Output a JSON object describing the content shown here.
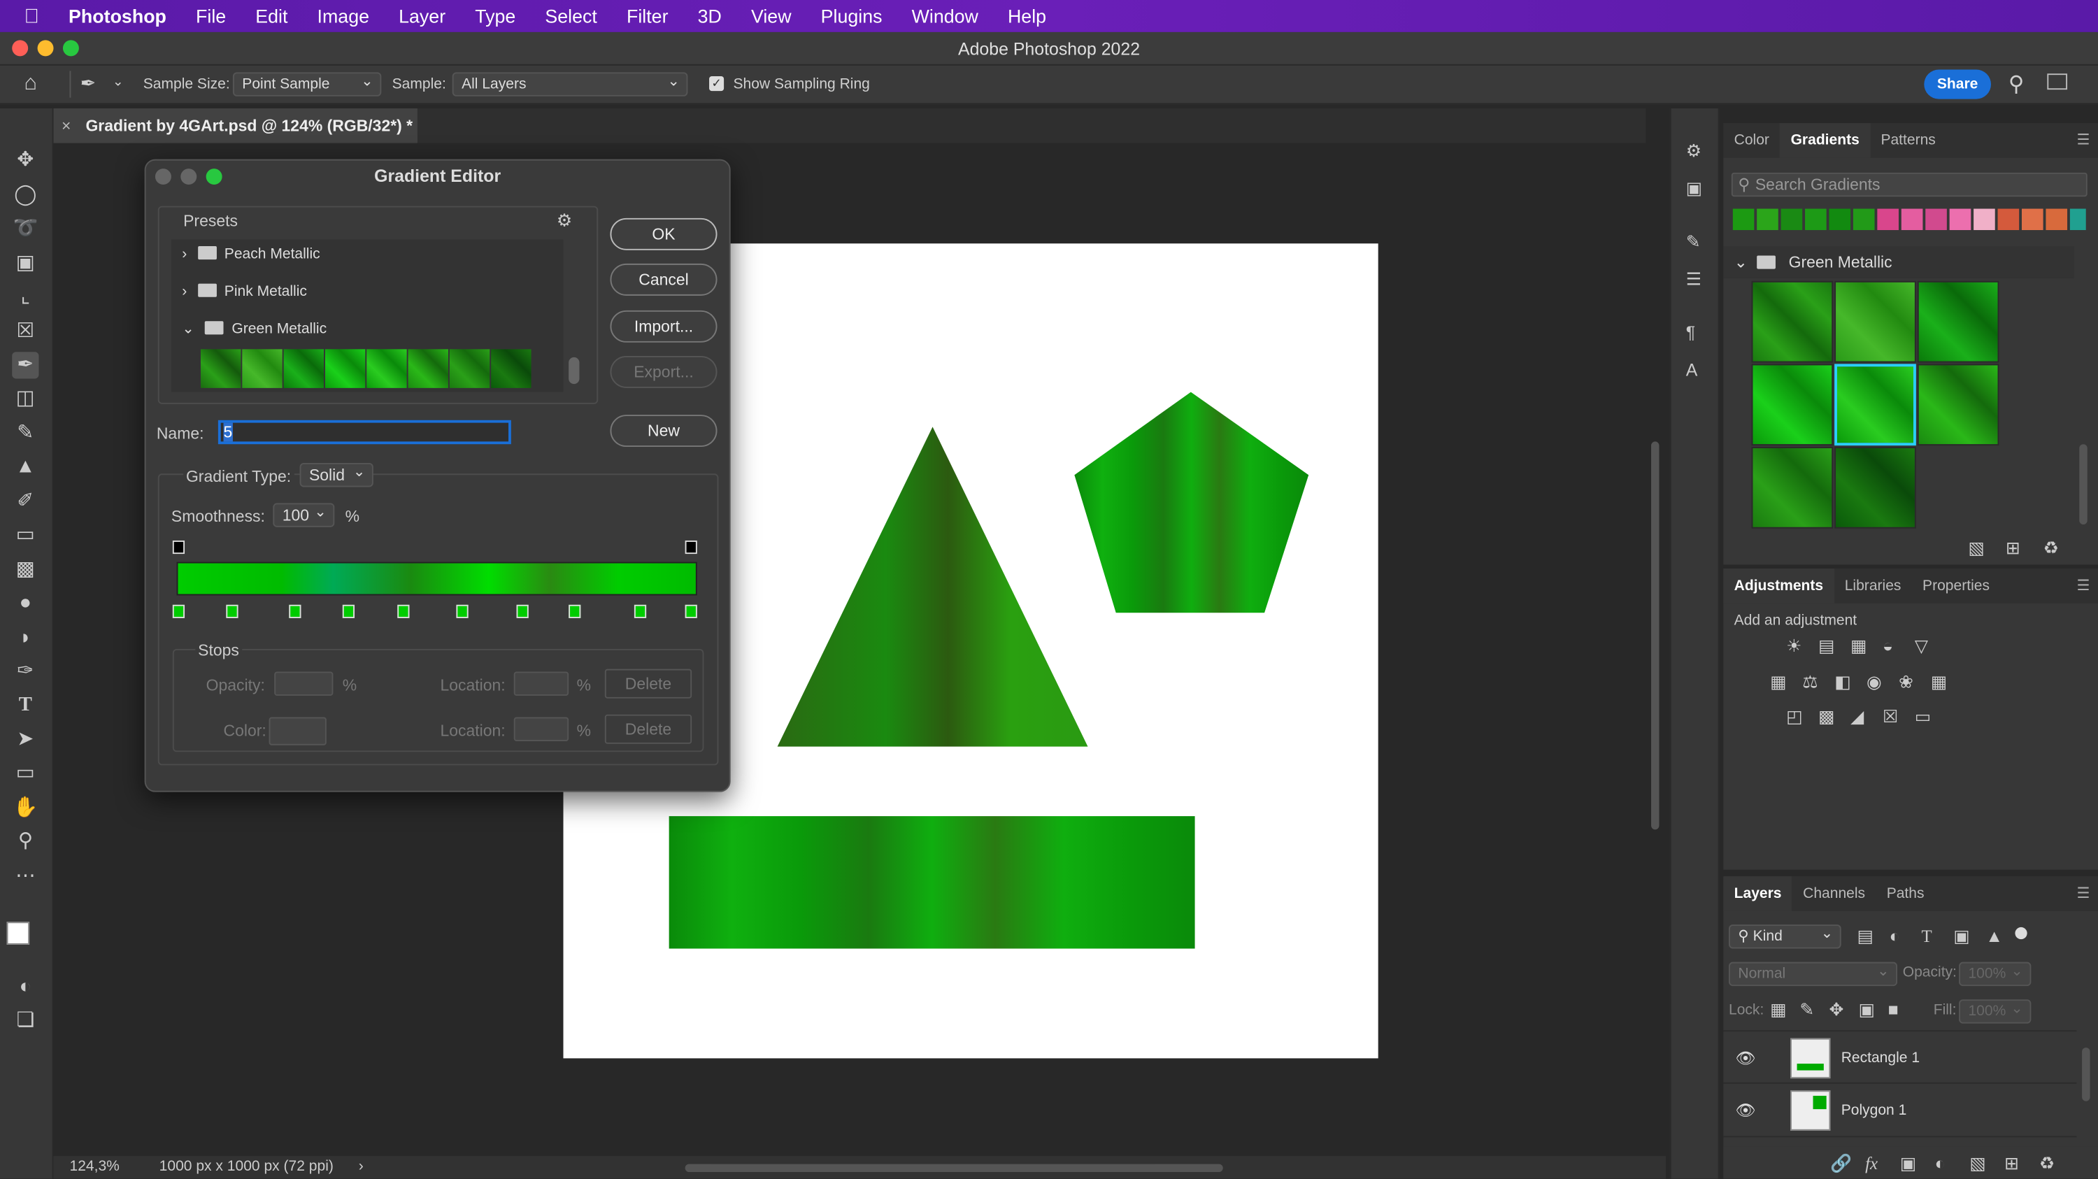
{
  "menubar": {
    "app": "Photoshop",
    "items": [
      "File",
      "Edit",
      "Image",
      "Layer",
      "Type",
      "Select",
      "Filter",
      "3D",
      "View",
      "Plugins",
      "Window",
      "Help"
    ]
  },
  "window": {
    "title": "Adobe Photoshop 2022"
  },
  "options": {
    "sample_size_label": "Sample Size:",
    "sample_size_value": "Point Sample",
    "sample_label": "Sample:",
    "sample_value": "All Layers",
    "show_ring_label": "Show Sampling Ring",
    "share_label": "Share"
  },
  "document": {
    "tab_title": "Gradient by 4GArt.psd @ 124% (RGB/32*) *",
    "zoom": "124,3%",
    "info": "1000 px x 1000 px (72 ppi)"
  },
  "dialog": {
    "title": "Gradient Editor",
    "presets_label": "Presets",
    "folders": [
      "Peach Metallic",
      "Pink Metallic",
      "Green Metallic"
    ],
    "buttons": {
      "ok": "OK",
      "cancel": "Cancel",
      "import": "Import...",
      "export": "Export...",
      "new": "New"
    },
    "name_label": "Name:",
    "name_value": "5",
    "gradient_type_label": "Gradient Type:",
    "gradient_type_value": "Solid",
    "smoothness_label": "Smoothness:",
    "smoothness_value": "100",
    "percent": "%",
    "stops_label": "Stops",
    "opacity_label": "Opacity:",
    "location_label": "Location:",
    "color_label": "Color:",
    "delete_label": "Delete"
  },
  "gradients_panel": {
    "tabs": [
      "Color",
      "Gradients",
      "Patterns"
    ],
    "search_placeholder": "Search Gradients",
    "group": "Green Metallic"
  },
  "adjustments_panel": {
    "tabs": [
      "Adjustments",
      "Libraries",
      "Properties"
    ],
    "add_label": "Add an adjustment"
  },
  "layers_panel": {
    "tabs": [
      "Layers",
      "Channels",
      "Paths"
    ],
    "kind_label": "Kind",
    "blend_mode": "Normal",
    "opacity_label": "Opacity:",
    "opacity_value": "100%",
    "lock_label": "Lock:",
    "fill_label": "Fill:",
    "fill_value": "100%",
    "layers": [
      "Rectangle 1",
      "Polygon 1"
    ]
  },
  "colors": {
    "accent": "#1a6fd8",
    "green": "#0c0",
    "menubar": "#6a1fb8"
  }
}
